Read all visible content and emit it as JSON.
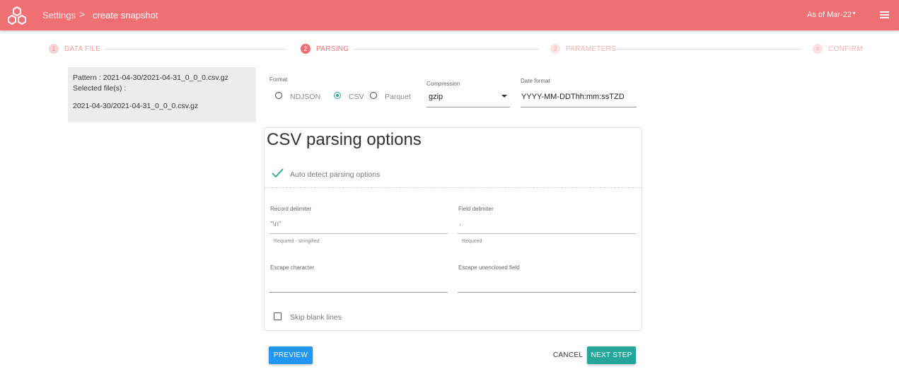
{
  "header": {
    "breadcrumb_root": "Settings",
    "breadcrumb_separator": ">",
    "breadcrumb_current": "create snapshot",
    "as_of": "As of Mar-22",
    "logo_icon": "hexagon-cluster-logo",
    "menu_icon": "hamburger-menu-icon"
  },
  "stepper": {
    "steps": [
      {
        "number": "1",
        "label": "DATA FILE",
        "state": "done"
      },
      {
        "number": "2",
        "label": "PARSING",
        "state": "active"
      },
      {
        "number": "3",
        "label": "PARAMETERS",
        "state": "upcoming"
      },
      {
        "number": "4",
        "label": "CONFIRM",
        "state": "upcoming"
      }
    ]
  },
  "file_info": {
    "pattern_line": "Pattern : 2021-04-30/2021-04-31_0_0_0.csv.gz",
    "selected_label": "Selected file(s) :",
    "selected_file": "2021-04-30/2021-04-31_0_0_0.csv.gz"
  },
  "format": {
    "label": "Format",
    "options": [
      "NDJSON",
      "CSV",
      "Parquet"
    ],
    "selected": "CSV"
  },
  "compression": {
    "label": "Compression",
    "value": "gzip"
  },
  "date_format": {
    "label": "Date format",
    "value": "YYYY-MM-DDThh:mm:ssTZD"
  },
  "csv_options": {
    "title": "CSV parsing options",
    "auto_detect_label": "Auto detect parsing options",
    "auto_detect_checked": true,
    "record_delimiter": {
      "label": "Record delimiter",
      "value": "\"\\n\"",
      "helper": "Required - stringified"
    },
    "field_delimiter": {
      "label": "Field delimiter",
      "value": ",",
      "helper": "Required"
    },
    "escape_character": {
      "label": "Escape character",
      "value": ""
    },
    "escape_unenclosed": {
      "label": "Escape unenclosed field",
      "value": ""
    },
    "skip_blank_label": "Skip blank lines",
    "skip_blank_checked": false
  },
  "actions": {
    "preview": "PREVIEW",
    "cancel": "CANCEL",
    "next": "NEXT STEP"
  },
  "colors": {
    "brand": "#f06f72",
    "accent": "#26a69a",
    "primary_button": "#2196f3"
  }
}
